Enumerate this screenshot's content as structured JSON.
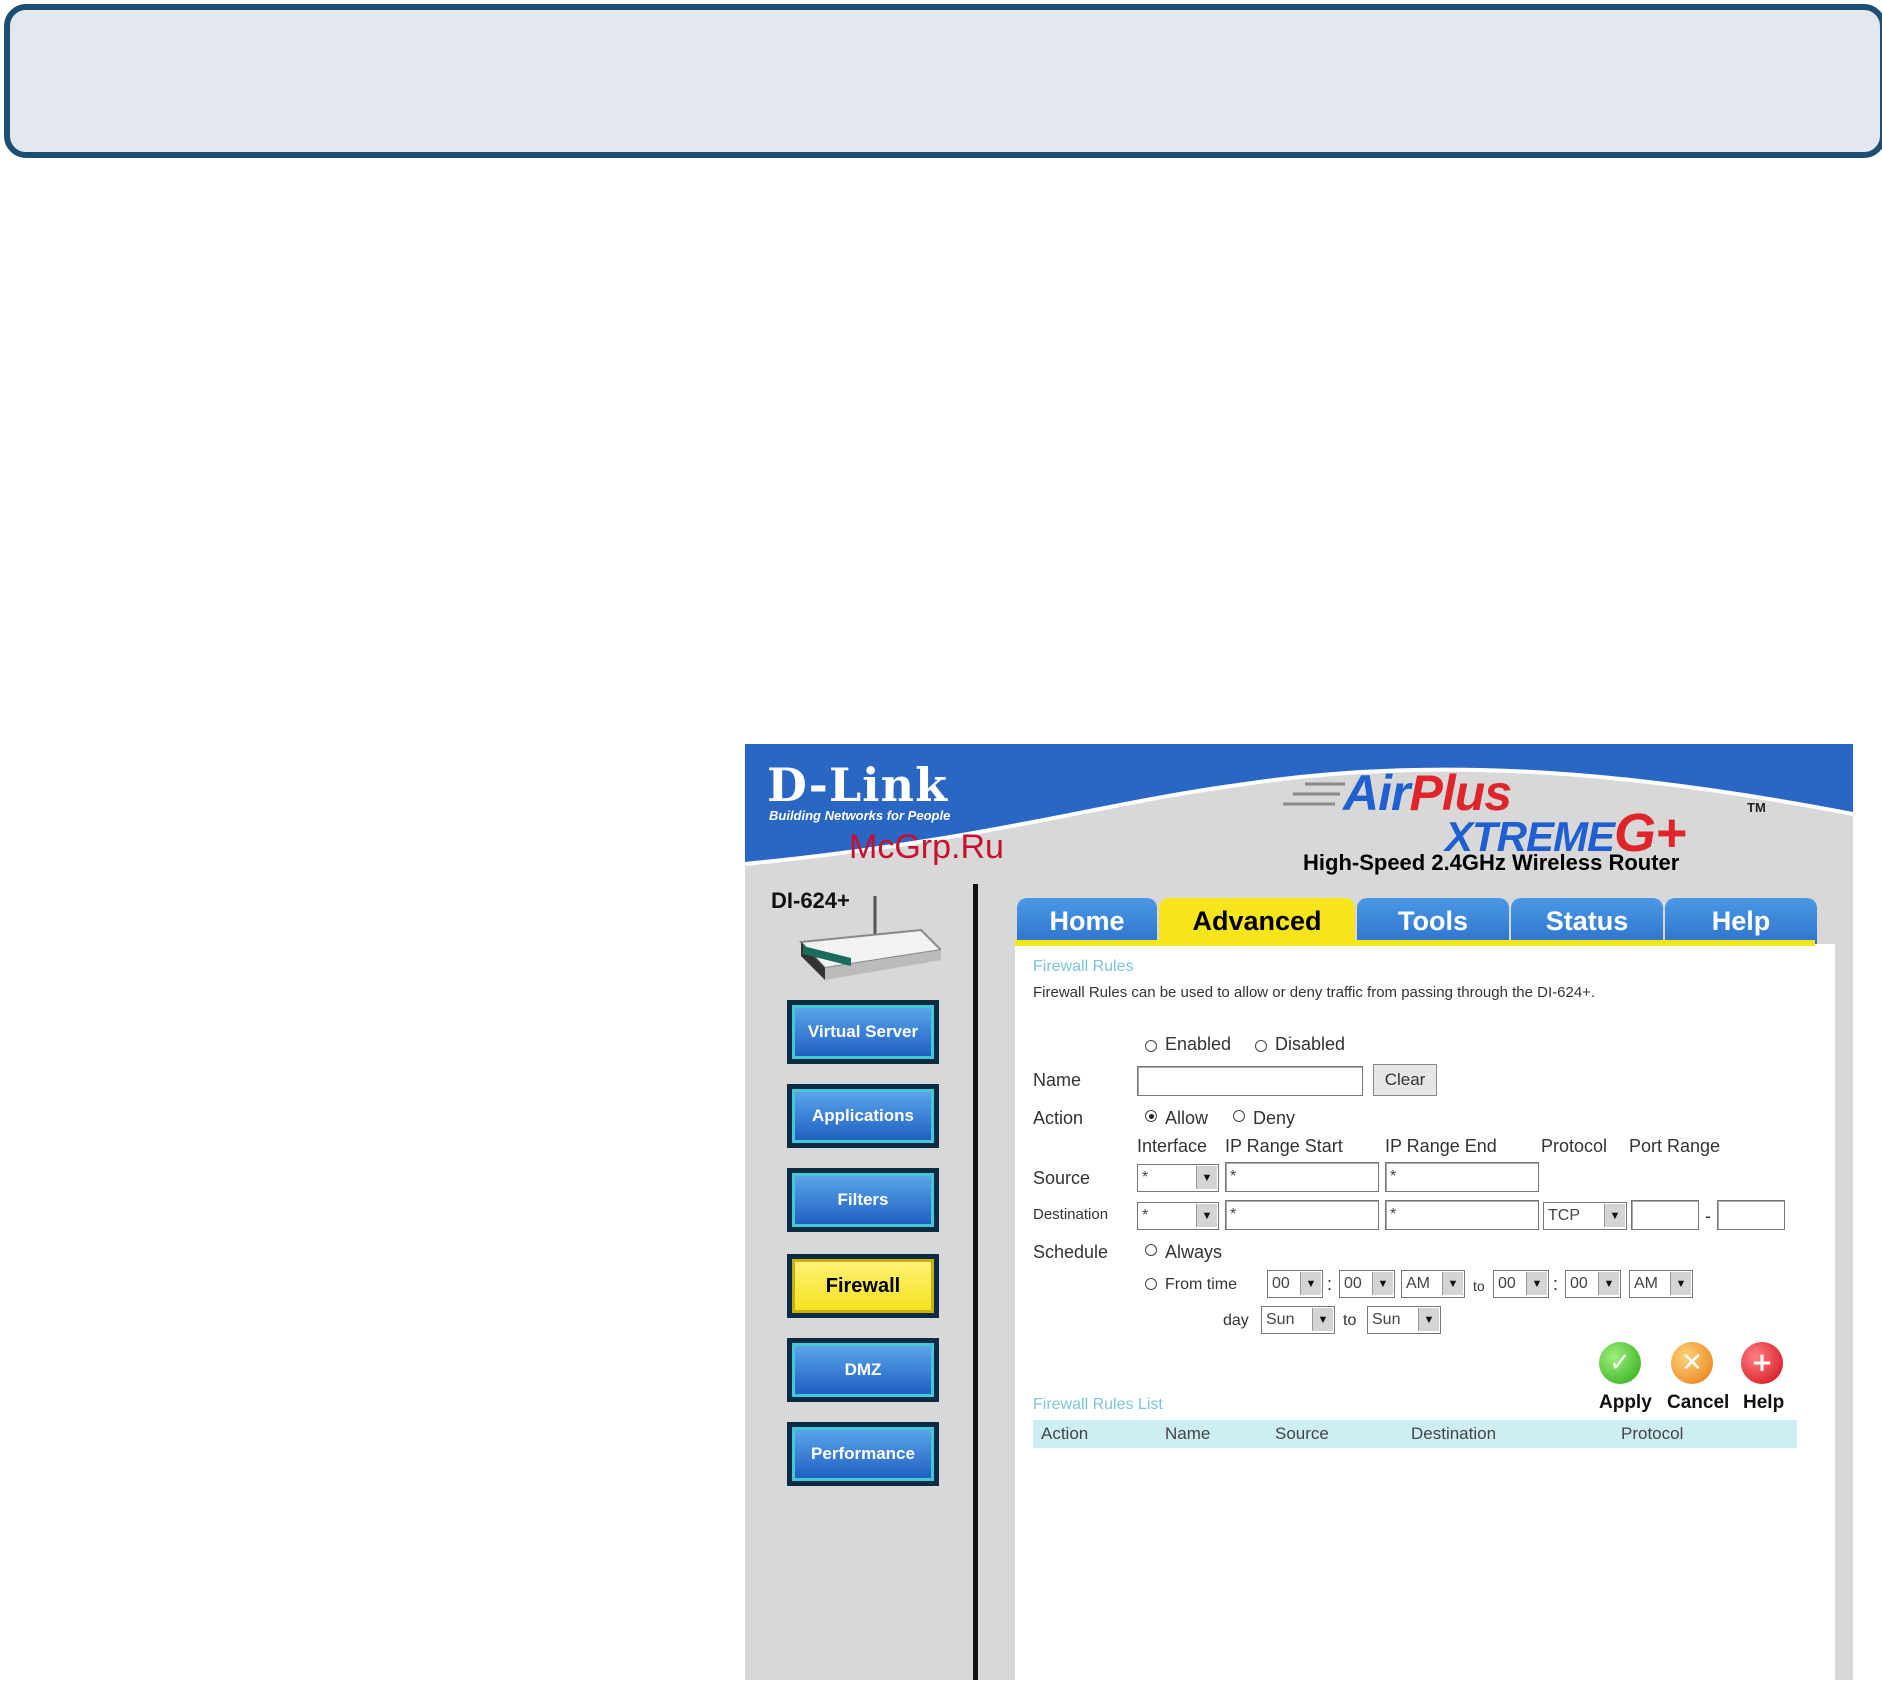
{
  "page": {
    "watermark": "McGrp.Ru"
  },
  "header": {
    "logo_text": "D-Link",
    "logo_tagline": "Building Networks for People",
    "product_line_1a": "Air",
    "product_line_1b": "Plus",
    "product_line_2a": "XTREME",
    "product_line_2b": "G+",
    "trademark": "TM",
    "subtitle": "High-Speed 2.4GHz Wireless Router",
    "model": "DI-624+"
  },
  "sidebar": {
    "items": [
      {
        "label": "Virtual Server"
      },
      {
        "label": "Applications"
      },
      {
        "label": "Filters"
      },
      {
        "label": "Firewall"
      },
      {
        "label": "DMZ"
      },
      {
        "label": "Performance"
      }
    ]
  },
  "tabs": [
    {
      "label": "Home"
    },
    {
      "label": "Advanced"
    },
    {
      "label": "Tools"
    },
    {
      "label": "Status"
    },
    {
      "label": "Help"
    }
  ],
  "form": {
    "section_title": "Firewall Rules",
    "description": "Firewall Rules can be used to allow or deny traffic from passing through the DI-624+.",
    "enabled_label": "Enabled",
    "disabled_label": "Disabled",
    "name_label": "Name",
    "name_value": "",
    "clear_label": "Clear",
    "action_label": "Action",
    "allow_label": "Allow",
    "deny_label": "Deny",
    "col_interface": "Interface",
    "col_ip_start": "IP Range Start",
    "col_ip_end": "IP Range End",
    "col_protocol": "Protocol",
    "col_port_range": "Port Range",
    "source_label": "Source",
    "source_interface": "*",
    "source_ip_start": "*",
    "source_ip_end": "*",
    "destination_label": "Destination",
    "destination_interface": "*",
    "destination_ip_start": "*",
    "destination_ip_end": "*",
    "destination_protocol": "TCP",
    "port_start": "",
    "port_dash": "-",
    "port_end": "",
    "schedule_label": "Schedule",
    "always_label": "Always",
    "from_time_label": "From  time",
    "from_hour": "00",
    "from_min": "00",
    "from_ampm": "AM",
    "to_label": "to",
    "to_hour": "00",
    "to_min": "00",
    "to_ampm": "AM",
    "colon": ":",
    "day_label": "day",
    "day_from": "Sun",
    "day_to_label": "to",
    "day_to": "Sun"
  },
  "actions": {
    "apply": "Apply",
    "cancel": "Cancel",
    "help": "Help"
  },
  "rules_list": {
    "title": "Firewall Rules List",
    "columns": [
      "Action",
      "Name",
      "Source",
      "Destination",
      "Protocol"
    ]
  },
  "colors": {
    "header_blue": "#2a66c4",
    "tab_active": "#f7e51c",
    "frame_border": "#1d4e74"
  }
}
